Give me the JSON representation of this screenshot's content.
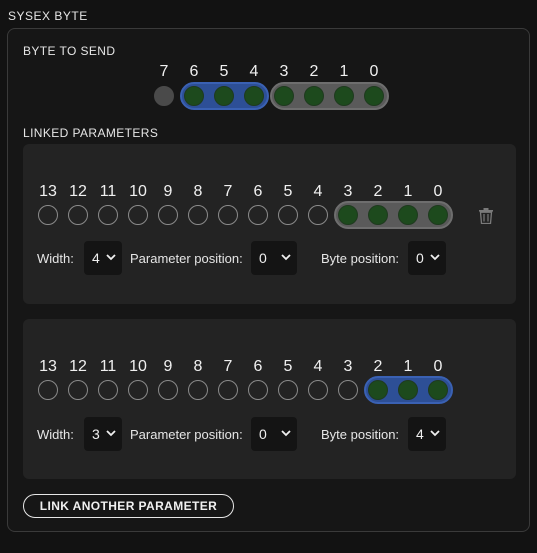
{
  "section_title": "SYSEX BYTE",
  "byte_to_send": {
    "label": "BYTE TO SEND",
    "bits": [
      "7",
      "6",
      "5",
      "4",
      "3",
      "2",
      "1",
      "0"
    ]
  },
  "linked_parameters": {
    "label": "LINKED PARAMETERS",
    "params": [
      {
        "bits": [
          "13",
          "12",
          "11",
          "10",
          "9",
          "8",
          "7",
          "6",
          "5",
          "4",
          "3",
          "2",
          "1",
          "0"
        ],
        "width_label": "Width:",
        "width_value": "4",
        "param_position_label": "Parameter position:",
        "param_position_value": "0",
        "byte_position_label": "Byte position:",
        "byte_position_value": "0",
        "highlight_color": "gray"
      },
      {
        "bits": [
          "13",
          "12",
          "11",
          "10",
          "9",
          "8",
          "7",
          "6",
          "5",
          "4",
          "3",
          "2",
          "1",
          "0"
        ],
        "width_label": "Width:",
        "width_value": "3",
        "param_position_label": "Parameter position:",
        "param_position_value": "0",
        "byte_position_label": "Byte position:",
        "byte_position_value": "4",
        "highlight_color": "blue"
      }
    ]
  },
  "link_button": "LINK ANOTHER PARAMETER",
  "colors": {
    "background": "#121212",
    "card": "#232323",
    "bit_filled": "#1d4a1d",
    "pill_gray": "#5a5a5a",
    "pill_blue": "#2d4f96"
  },
  "icons": {
    "delete": "trash-icon",
    "dropdown": "chevron-down-icon"
  }
}
